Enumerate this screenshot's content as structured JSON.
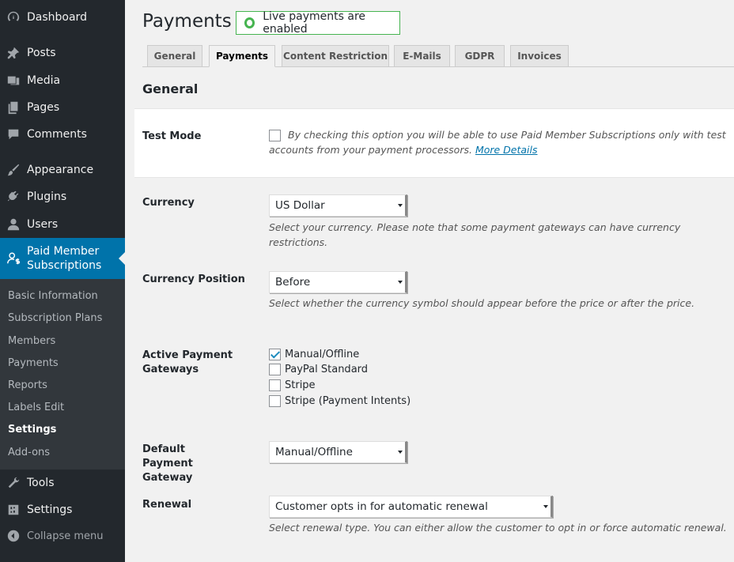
{
  "sidebar": {
    "items": [
      {
        "label": "Dashboard",
        "icon": "dashboard-icon"
      },
      {
        "label": "Posts",
        "icon": "pin-icon"
      },
      {
        "label": "Media",
        "icon": "media-icon"
      },
      {
        "label": "Pages",
        "icon": "pages-icon"
      },
      {
        "label": "Comments",
        "icon": "comment-icon"
      },
      {
        "label": "Appearance",
        "icon": "brush-icon"
      },
      {
        "label": "Plugins",
        "icon": "plugin-icon"
      },
      {
        "label": "Users",
        "icon": "user-icon"
      }
    ],
    "active": {
      "label": "Paid Member Subscriptions",
      "icon": "member-dollar-icon"
    },
    "submenu": [
      "Basic Information",
      "Subscription Plans",
      "Members",
      "Payments",
      "Reports",
      "Labels Edit",
      "Settings",
      "Add-ons"
    ],
    "submenu_current": "Settings",
    "tools": "Tools",
    "settings": "Settings",
    "collapse": "Collapse menu"
  },
  "header": {
    "title": "Payments",
    "badge": "Live payments are enabled"
  },
  "tabs": [
    "General",
    "Payments",
    "Content Restriction",
    "E-Mails",
    "GDPR",
    "Invoices"
  ],
  "active_tab": "Payments",
  "section_title": "General",
  "test_mode": {
    "label": "Test Mode",
    "checked": false,
    "description": "By checking this option you will be able to use Paid Member Subscriptions only with test accounts from your payment processors.",
    "link": "More Details"
  },
  "currency": {
    "label": "Currency",
    "value": "US Dollar",
    "description": "Select your currency. Please note that some payment gateways can have currency restrictions."
  },
  "currency_position": {
    "label": "Currency Position",
    "value": "Before",
    "description": "Select whether the currency symbol should appear before the price or after the price."
  },
  "gateways": {
    "label": "Active Payment Gateways",
    "items": [
      {
        "label": "Manual/Offline",
        "checked": true
      },
      {
        "label": "PayPal Standard",
        "checked": false
      },
      {
        "label": "Stripe",
        "checked": false
      },
      {
        "label": "Stripe (Payment Intents)",
        "checked": false
      }
    ]
  },
  "default_gateway": {
    "label": "Default Payment Gateway",
    "value": "Manual/Offline"
  },
  "renewal": {
    "label": "Renewal",
    "value": "Customer opts in for automatic renewal",
    "description": "Select renewal type. You can either allow the customer to opt in or force automatic renewal."
  },
  "colors": {
    "sidebar": "#23282d",
    "submenu": "#32373c",
    "accent": "#0073aa",
    "success": "#46b450"
  }
}
